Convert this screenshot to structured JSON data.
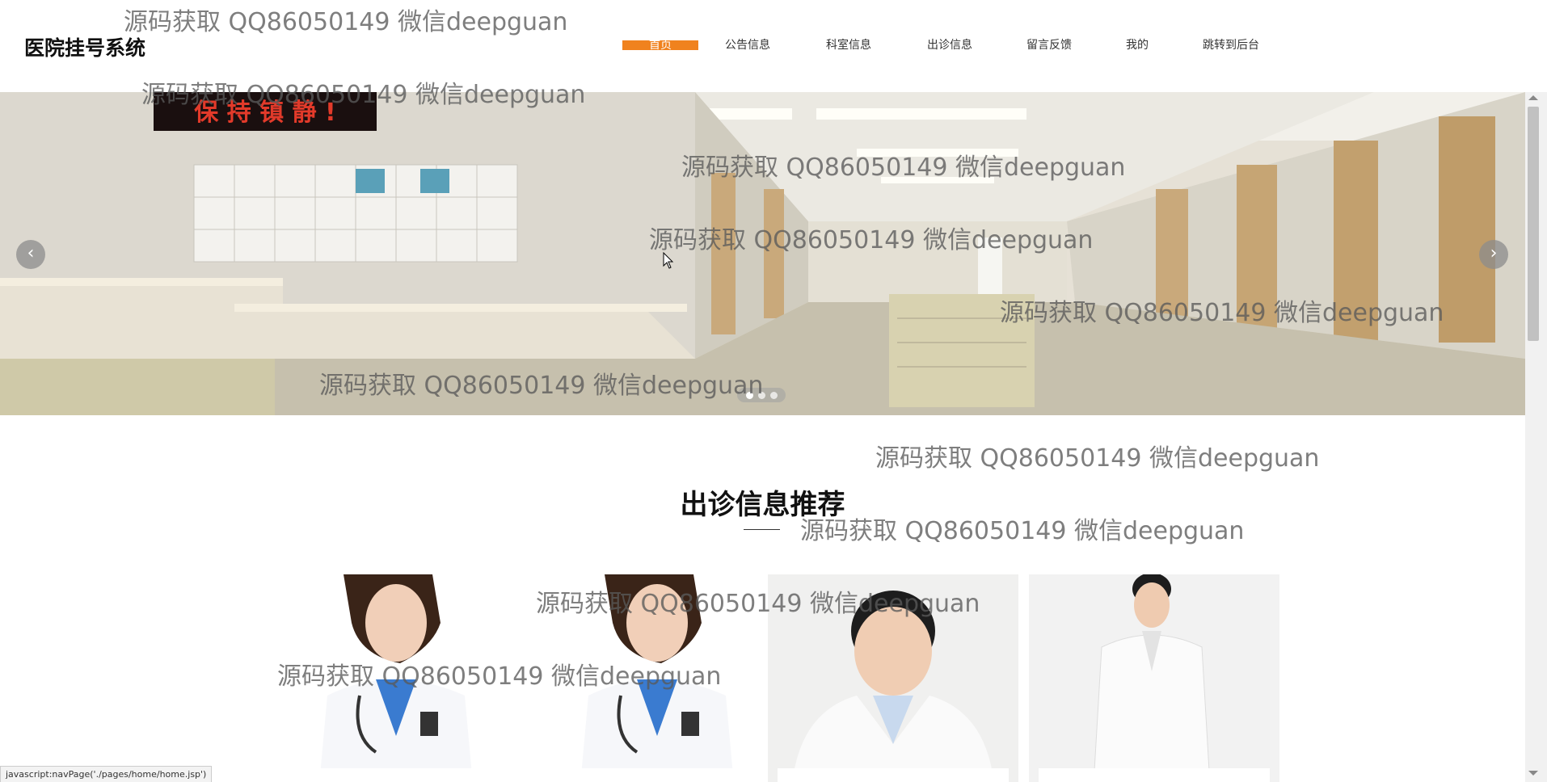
{
  "header": {
    "title": "医院挂号系统",
    "nav": [
      {
        "label": "首页",
        "active": true
      },
      {
        "label": "公告信息"
      },
      {
        "label": "科室信息"
      },
      {
        "label": "出诊信息"
      },
      {
        "label": "留言反馈"
      },
      {
        "label": "我的"
      },
      {
        "label": "跳转到后台"
      }
    ]
  },
  "hero": {
    "sign_text": "保 持 镇 静 !",
    "prev_icon": "chevron-left-icon",
    "next_icon": "chevron-right-icon",
    "slides": 3,
    "active_slide": 1
  },
  "section": {
    "title": "出诊信息推荐",
    "cards_count": 4
  },
  "watermark": "源码获取 QQ86050149 微信deepguan",
  "statusbar": "javascript:navPage('./pages/home/home.jsp')",
  "colors": {
    "accent": "#f0821e",
    "watermark": "#5a5a5a"
  }
}
